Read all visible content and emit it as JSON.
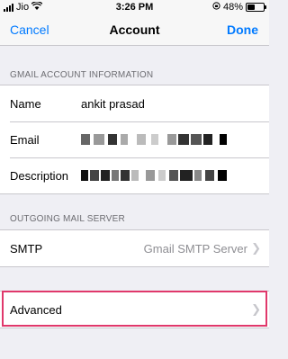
{
  "status_bar": {
    "carrier": "Jio",
    "time": "3:26 PM",
    "battery": "48%",
    "battery_level": 0.48
  },
  "nav": {
    "cancel": "Cancel",
    "title": "Account",
    "done": "Done"
  },
  "account_info": {
    "header": "GMAIL ACCOUNT INFORMATION",
    "name_label": "Name",
    "name_value": "ankit prasad",
    "email_label": "Email",
    "description_label": "Description"
  },
  "outgoing": {
    "header": "OUTGOING MAIL SERVER",
    "smtp_label": "SMTP",
    "smtp_value": "Gmail SMTP Server"
  },
  "advanced": {
    "label": "Advanced"
  },
  "colors": {
    "accent": "#007aff",
    "highlight": "#e0386b"
  }
}
